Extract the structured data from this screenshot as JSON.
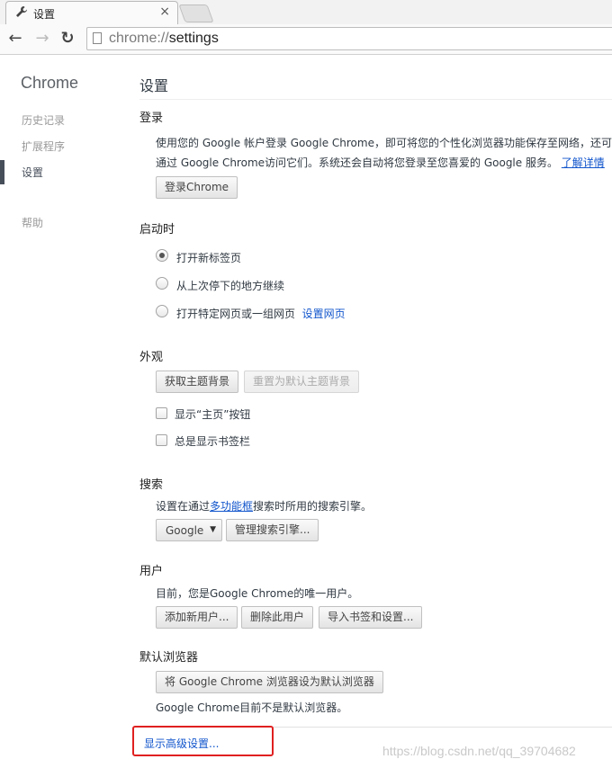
{
  "tab": {
    "icon": "wrench-icon",
    "title": "设置",
    "close": "×"
  },
  "toolbar": {
    "back": "←",
    "forward": "→",
    "reload": "↻",
    "url_scheme": "chrome://",
    "url_path": "settings"
  },
  "sidebar": {
    "title": "Chrome",
    "items": [
      {
        "label": "历史记录",
        "active": false
      },
      {
        "label": "扩展程序",
        "active": false
      },
      {
        "label": "设置",
        "active": true
      },
      {
        "label": "帮助",
        "active": false
      }
    ]
  },
  "main": {
    "title": "设置",
    "signin": {
      "title": "登录",
      "desc_line1": "使用您的 Google 帐户登录 Google Chrome，即可将您的个性化浏览器功能保存至网络，还可从任",
      "desc_line2": "通过 Google Chrome访问它们。系统还会自动将您登录至您喜爱的 Google 服务。",
      "learn_more": "了解详情",
      "button": "登录Chrome"
    },
    "startup": {
      "title": "启动时",
      "options": [
        {
          "label": "打开新标签页",
          "checked": true
        },
        {
          "label": "从上次停下的地方继续",
          "checked": false
        },
        {
          "label": "打开特定网页或一组网页",
          "checked": false
        }
      ],
      "set_pages_link": "设置网页"
    },
    "appearance": {
      "title": "外观",
      "get_themes": "获取主题背景",
      "reset_theme": "重置为默认主题背景",
      "show_home": "显示“主页”按钮",
      "show_bookmarks": "总是显示书签栏"
    },
    "search": {
      "title": "搜索",
      "desc_before": "设置在通过",
      "omnibox_link": "多功能框",
      "desc_after": "搜索时所用的搜索引擎。",
      "engine": "Google",
      "manage": "管理搜索引擎..."
    },
    "users": {
      "title": "用户",
      "desc": "目前，您是Google Chrome的唯一用户。",
      "add": "添加新用户...",
      "delete": "删除此用户",
      "import": "导入书签和设置..."
    },
    "default_browser": {
      "title": "默认浏览器",
      "button": "将 Google Chrome 浏览器设为默认浏览器",
      "status": "Google Chrome目前不是默认浏览器。"
    },
    "advanced_link": "显示高级设置..."
  },
  "watermark": "https://blog.csdn.net/qq_39704682",
  "colors": {
    "link": "#1155cc",
    "highlight": "#e02020"
  }
}
